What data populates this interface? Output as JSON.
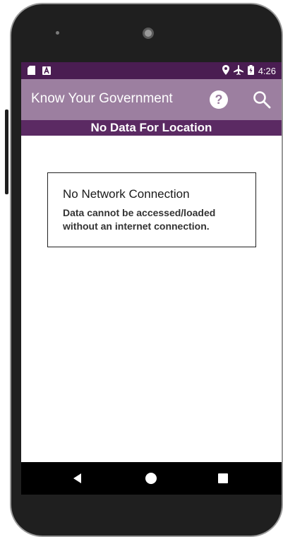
{
  "status_bar": {
    "time": "4:26",
    "left_icons": [
      "sd-card-icon",
      "notification-a-icon"
    ],
    "right_icons": [
      "location-icon",
      "airplane-mode-icon",
      "battery-charging-icon"
    ]
  },
  "app_bar": {
    "title": "Know Your Government",
    "help_label": "?",
    "help_icon": "help-circle-icon",
    "search_icon": "search-icon",
    "background_color": "#9c7fa0"
  },
  "location_banner": {
    "text": "No Data For Location",
    "background_color": "#5b2a63"
  },
  "dialog": {
    "title": "No Network Connection",
    "message": "Data cannot be accessed/loaded without an internet connection."
  },
  "nav_bar": {
    "icons": [
      "back-triangle-icon",
      "home-circle-icon",
      "recents-square-icon"
    ]
  },
  "colors": {
    "status_bar": "#4a1d52",
    "accent": "#5b2a63",
    "app_bar": "#9c7fa0"
  }
}
